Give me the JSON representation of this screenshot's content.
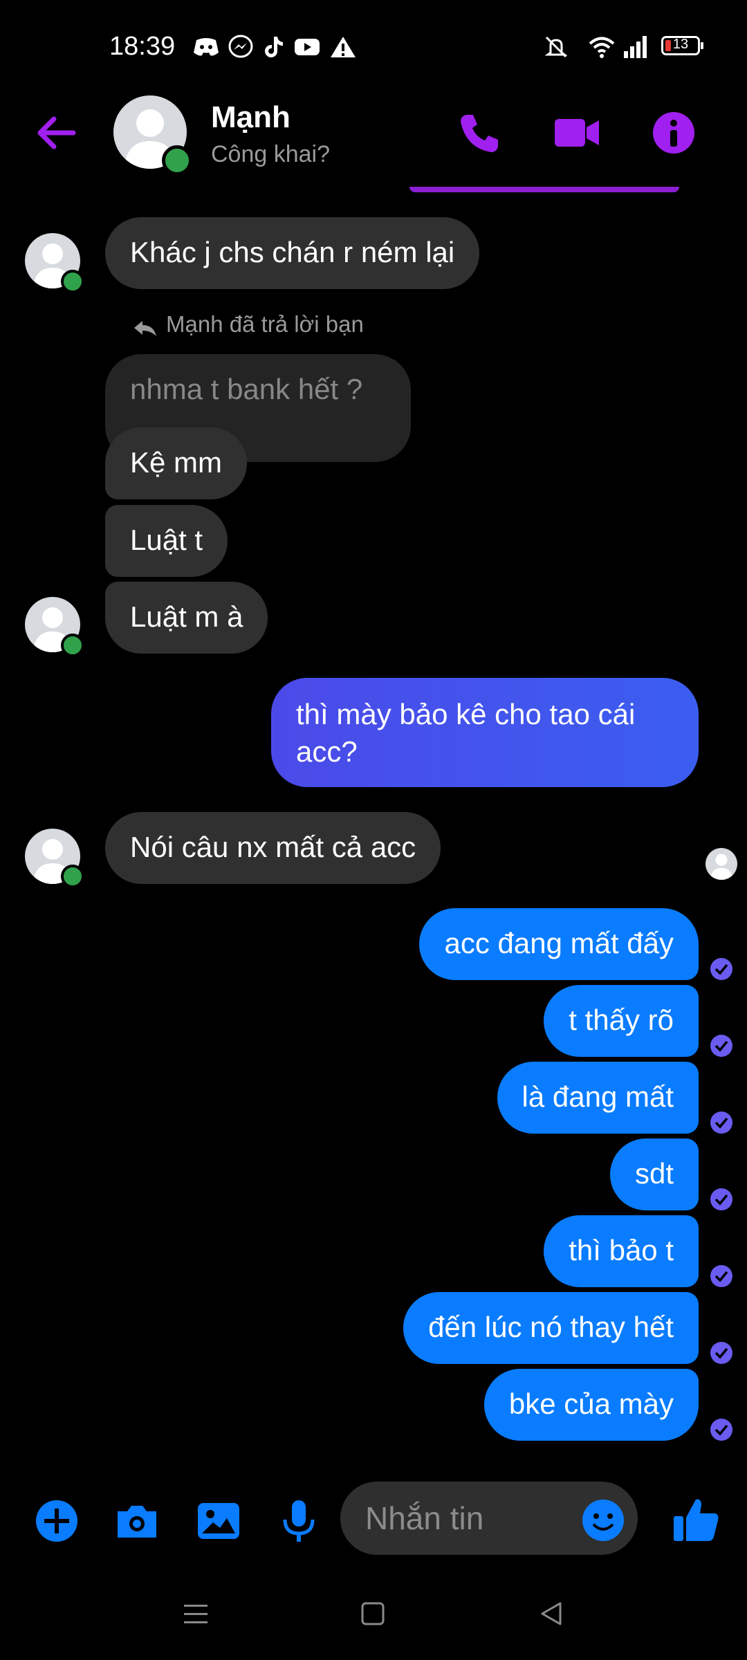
{
  "status_bar": {
    "time": "18:39",
    "battery": "13",
    "notification_icons": [
      "discord-icon",
      "messenger-icon",
      "tiktok-icon",
      "youtube-icon",
      "warning-icon"
    ],
    "system_icons": [
      "mute-icon",
      "wifi-icon",
      "signal-icon",
      "battery-icon"
    ]
  },
  "header": {
    "contact_name": "Mạnh",
    "subtitle": "Công khai?",
    "accent": "#a020f0"
  },
  "conversation": {
    "messages": [
      {
        "from": "them",
        "text": "Khác j chs chán r ném lại"
      },
      {
        "reply_note": "Mạnh đã trả lời bạn",
        "quoted": "nhma t bank hết ?"
      },
      {
        "from": "them",
        "text": "Kệ mm"
      },
      {
        "from": "them",
        "text": "Luật t"
      },
      {
        "from": "them",
        "text": "Luật m à"
      },
      {
        "from": "me",
        "text": "thì mày bảo kê cho tao cái acc?"
      },
      {
        "from": "them",
        "text": "Nói câu nx mất cả acc"
      },
      {
        "from": "me",
        "text": "acc đang mất đấy"
      },
      {
        "from": "me",
        "text": "t thấy rõ"
      },
      {
        "from": "me",
        "text": "là đang mất"
      },
      {
        "from": "me",
        "text": "sdt"
      },
      {
        "from": "me",
        "text": "thì bảo t"
      },
      {
        "from": "me",
        "text": "đến lúc nó thay hết"
      },
      {
        "from": "me",
        "text": "bke của mày"
      }
    ]
  },
  "composer": {
    "placeholder": "Nhắn tin",
    "buttons": [
      "add-icon",
      "camera-icon",
      "gallery-icon",
      "microphone-icon",
      "emoji-icon",
      "thumbs-up-icon"
    ],
    "accent": "#0a7cff"
  }
}
